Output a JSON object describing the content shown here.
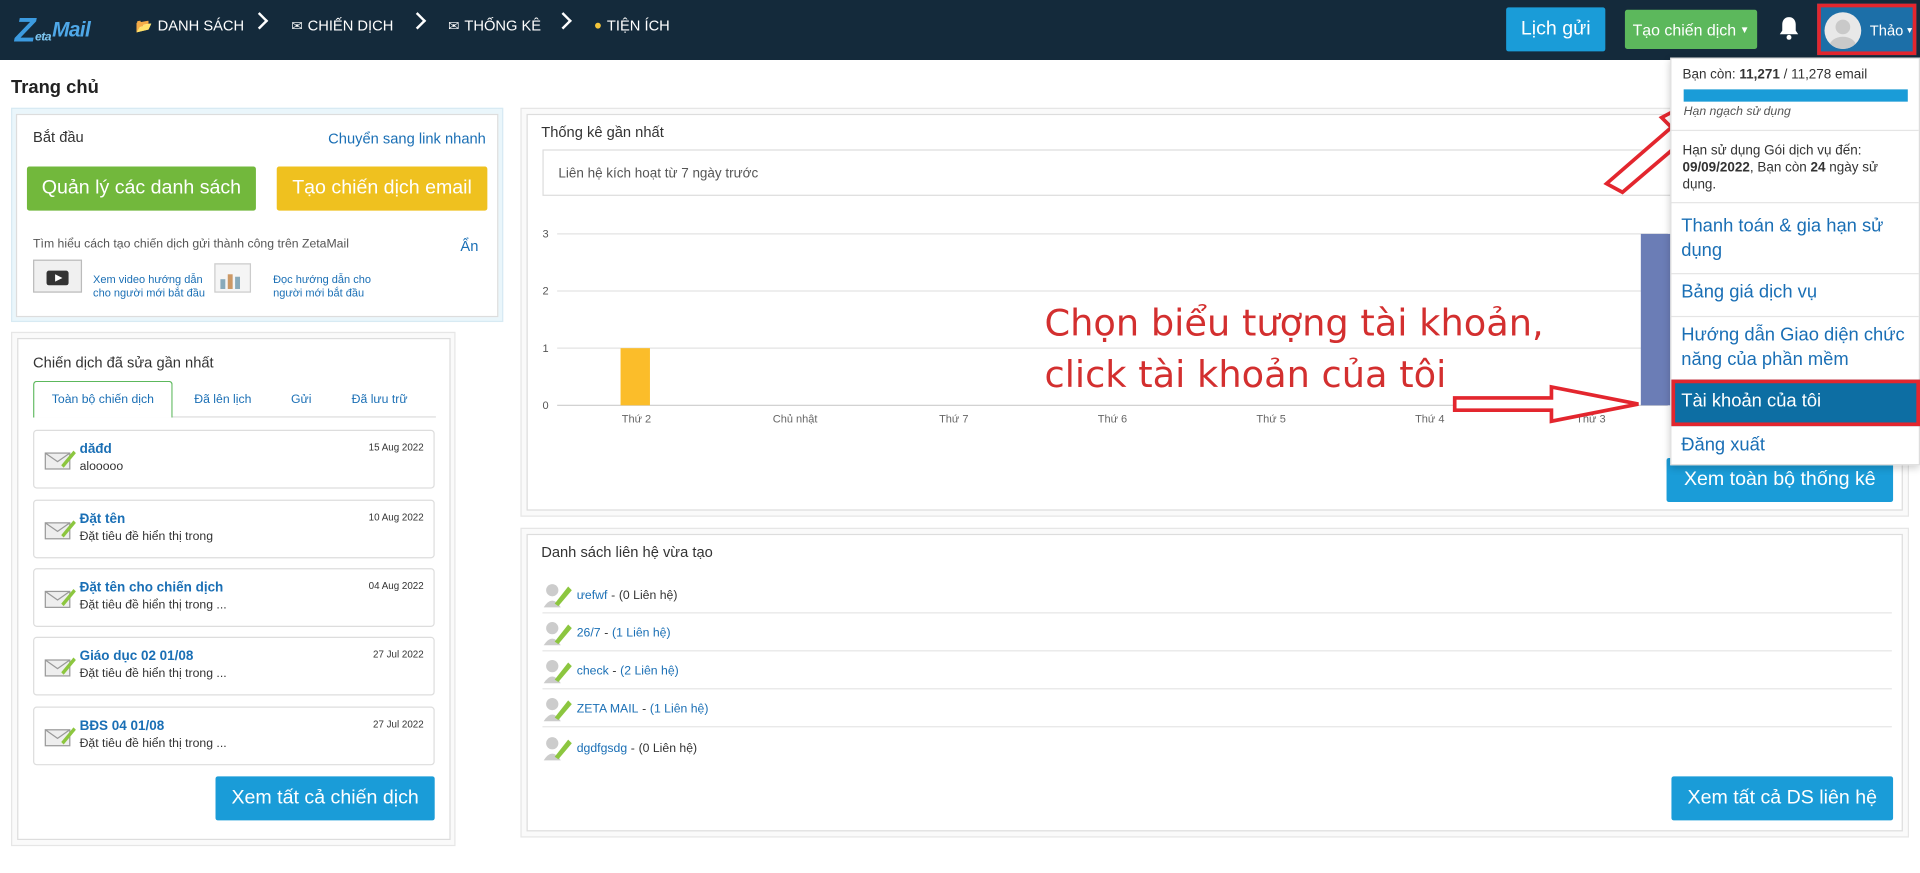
{
  "logo": {
    "z": "Z",
    "eta": "eta",
    "mail": "Mail"
  },
  "nav": [
    {
      "label": "DANH SÁCH",
      "icon": "list-folder-icon"
    },
    {
      "label": "CHIẾN DỊCH",
      "icon": "envelope-icon"
    },
    {
      "label": "THỐNG KÊ",
      "icon": "envelope-stats-icon"
    },
    {
      "label": "TIỆN ÍCH",
      "icon": "utility-icon"
    }
  ],
  "header": {
    "schedule_label": "Lịch gửi",
    "create_campaign_label": "Tạo chiến dịch",
    "username": "Thảo"
  },
  "page_title": "Trang chủ",
  "start": {
    "title": "Bắt đầu",
    "quick_link": "Chuyển sang link nhanh",
    "manage_lists": "Quản lý các danh sách",
    "create_email": "Tạo chiến dịch email",
    "learn_text": "Tìm hiểu cách tạo chiến dịch gửi thành công trên ZetaMail",
    "hide": "Ẩn",
    "video_link": "Xem video hướng dẫn cho người mới bắt đầu",
    "guide_link": "Đọc hướng dẫn cho người mới bắt đầu"
  },
  "recent": {
    "title": "Chiến dịch đã sửa gần nhất",
    "tabs": [
      "Toàn bộ chiến dịch",
      "Đã lên lịch",
      "Gửi",
      "Đã lưu trữ"
    ],
    "items": [
      {
        "name": "dăđd",
        "desc": "alooooo",
        "date": "15 Aug 2022"
      },
      {
        "name": "Đặt tên",
        "desc": "Đặt tiêu đề hiển thị trong",
        "date": "10 Aug 2022"
      },
      {
        "name": "Đặt tên cho chiến dịch",
        "desc": "Đặt tiêu đề hiển thị trong ...",
        "date": "04 Aug 2022"
      },
      {
        "name": "Giáo dục 02 01/08",
        "desc": "Đặt tiêu đề hiển thị trong ...",
        "date": "27 Jul 2022"
      },
      {
        "name": "BĐS 04 01/08",
        "desc": "Đặt tiêu đề hiển thị trong ...",
        "date": "27 Jul 2022"
      }
    ],
    "view_all": "Xem tất cả chiến dịch"
  },
  "stats": {
    "title": "Thống kê gần nhất",
    "select_value": "Liên hệ kích hoạt từ 7 ngày trước",
    "view_all": "Xem toàn bộ thống kê"
  },
  "chart_data": {
    "type": "bar",
    "categories": [
      "Thứ 2",
      "Chủ nhật",
      "Thứ 7",
      "Thứ 6",
      "Thứ 5",
      "Thứ 4",
      "Thứ 3"
    ],
    "values": [
      1,
      0,
      0,
      0,
      0,
      0,
      3
    ],
    "ylim": [
      0,
      3
    ],
    "yticks": [
      "0",
      "1",
      "2",
      "3"
    ],
    "colors": {
      "first": "#fbbd2a",
      "last": "#6b7db6"
    }
  },
  "contacts": {
    "title": "Danh sách liên hệ vừa tạo",
    "items": [
      {
        "name": "ưefwf",
        "count": "(0 Liên hệ)",
        "linked": false
      },
      {
        "name": "26/7",
        "count": "(1 Liên hệ)",
        "linked": true
      },
      {
        "name": "check",
        "count": "(2 Liên hệ)",
        "linked": true
      },
      {
        "name": "ZETA MAIL",
        "count": "(1 Liên hệ)",
        "linked": true
      },
      {
        "name": "dgdfgsdg",
        "count": "(0 Liên hệ)",
        "linked": false
      }
    ],
    "view_all": "Xem tất cả DS liên hệ"
  },
  "account_menu": {
    "quota_prefix": "Bạn còn:",
    "quota_left": "11,271",
    "quota_total": "/ 11,278 email",
    "quota_fraction": 0.9994,
    "quota_label": "Hạn ngạch sử dụng",
    "expiry_text": "Hạn sử dụng Gói dịch vụ đến:",
    "expiry_date": "09/09/2022",
    "expiry_mid": ", Bạn còn",
    "expiry_days": "24",
    "expiry_tail": "ngày sử dụng.",
    "items": [
      "Thanh toán & gia hạn sử dụng",
      "Bảng giá dịch vụ",
      "Hướng dẫn Giao diện chức năng của phần mềm",
      "Tài khoản của tôi",
      "Đăng xuất"
    ]
  },
  "annotation": {
    "line1": "Chọn biểu tượng tài khoản,",
    "line2": "click tài khoản của tôi"
  },
  "colors": {
    "nav_bg": "#142a3b",
    "primary": "#1a9cd8",
    "green": "#72b83c",
    "yellow": "#efc11f",
    "highlight": "#e3262e",
    "annotation": "#d32f2f"
  }
}
